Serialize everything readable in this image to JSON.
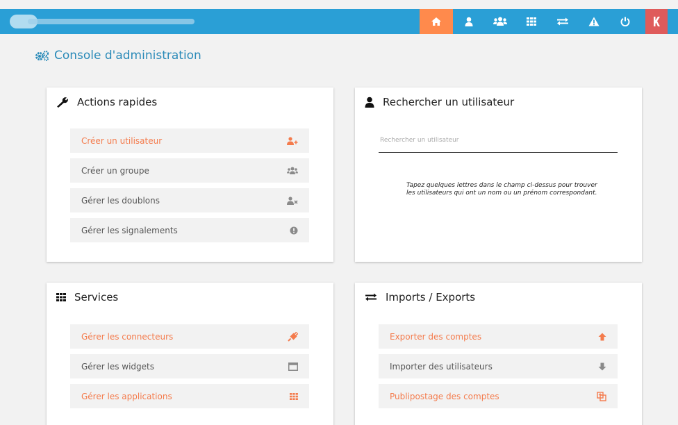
{
  "page_title": "Console d'administration",
  "quick_actions": {
    "title": "Actions rapides",
    "items": [
      {
        "label": "Créer un utilisateur",
        "icon": "user-plus-icon"
      },
      {
        "label": "Créer un groupe",
        "icon": "users-icon"
      },
      {
        "label": "Gérer les doublons",
        "icon": "user-times-icon"
      },
      {
        "label": "Gérer les signalements",
        "icon": "exclamation-circle-icon"
      }
    ]
  },
  "user_search": {
    "title": "Rechercher un utilisateur",
    "placeholder": "Rechercher un utilisateur",
    "hint": "Tapez quelques lettres dans le champ ci-dessus pour trouver les utilisateurs qui ont un nom ou un prénom correspondant."
  },
  "services": {
    "title": "Services",
    "items": [
      {
        "label": "Gérer les connecteurs",
        "icon": "plug-icon"
      },
      {
        "label": "Gérer les widgets",
        "icon": "window-icon"
      },
      {
        "label": "Gérer les applications",
        "icon": "apps-grid-icon"
      }
    ]
  },
  "imports_exports": {
    "title": "Imports / Exports",
    "items": [
      {
        "label": "Exporter des comptes",
        "icon": "arrow-up-icon"
      },
      {
        "label": "Importer des utilisateurs",
        "icon": "arrow-down-icon"
      },
      {
        "label": "Publipostage des comptes",
        "icon": "mail-merge-icon"
      }
    ]
  },
  "colors": {
    "topbar": "#2a9fd6",
    "accent": "#f47b4c",
    "home_button": "#ff8a4c",
    "logout_button": "#df5b5b",
    "title": "#2a8ab8"
  }
}
